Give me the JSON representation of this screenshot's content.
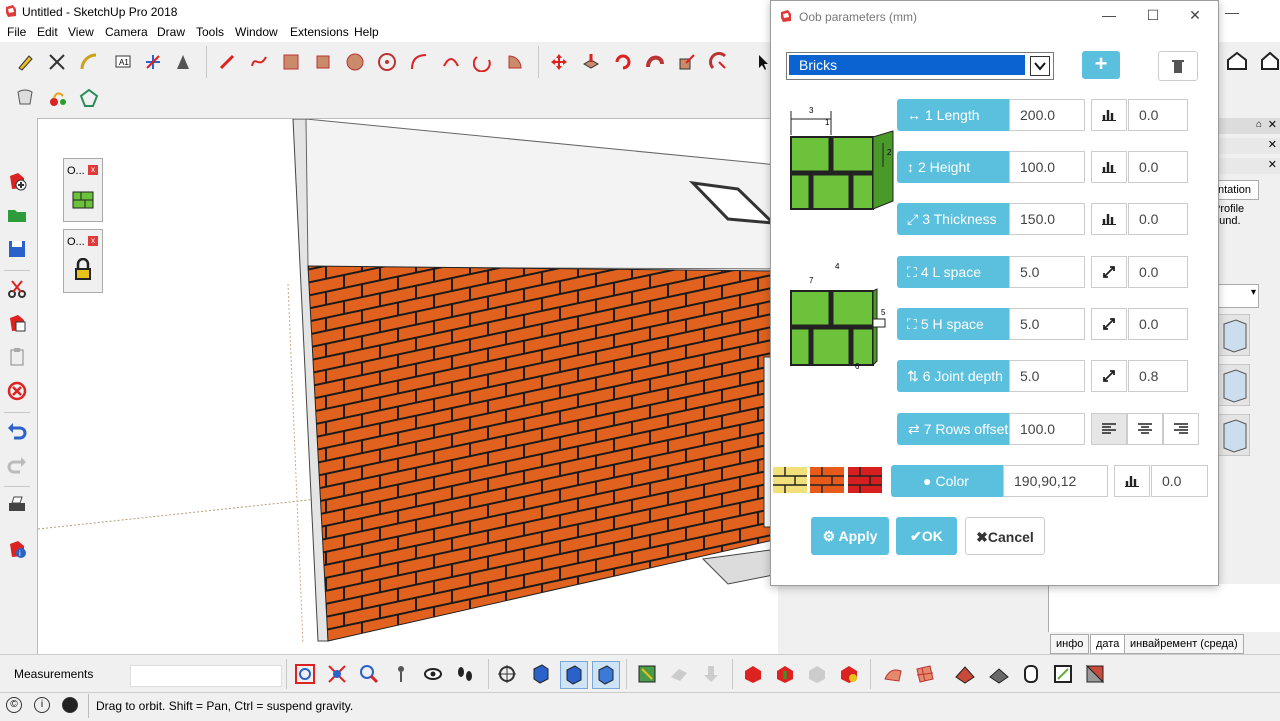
{
  "window": {
    "title": "Untitled - SketchUp Pro 2018"
  },
  "menu": [
    "File",
    "Edit",
    "View",
    "Camera",
    "Draw",
    "Tools",
    "Window",
    "Extensions",
    "Help"
  ],
  "mini_toolbars": [
    {
      "label": "O..."
    },
    {
      "label": "O..."
    }
  ],
  "dialog": {
    "title": "Oob parameters (mm)",
    "preset": "Bricks",
    "params": [
      {
        "label": "1 Length",
        "value": "200.0",
        "extra": "0.0",
        "icon": "arrows-horizontal-icon",
        "mode": "bar-chart-icon"
      },
      {
        "label": "2 Height",
        "value": "100.0",
        "extra": "0.0",
        "icon": "arrows-vertical-icon",
        "mode": "bar-chart-icon"
      },
      {
        "label": "3 Thickness",
        "value": "150.0",
        "extra": "0.0",
        "icon": "arrows-diagonal-icon",
        "mode": "bar-chart-icon"
      },
      {
        "label": "4 L space",
        "value": "5.0",
        "extra": "0.0",
        "icon": "compress-icon",
        "mode": "expand-icon"
      },
      {
        "label": "5 H space",
        "value": "5.0",
        "extra": "0.0",
        "icon": "compress-icon",
        "mode": "expand-icon"
      },
      {
        "label": "6 Joint depth",
        "value": "5.0",
        "extra": "0.8",
        "icon": "sort-icon",
        "mode": "expand-icon"
      }
    ],
    "rows_offset": {
      "label": "7 Rows offset",
      "value": "100.0"
    },
    "color": {
      "label": "Color",
      "value": "190,90,12",
      "extra": "0.0"
    },
    "swatches": [
      "#f2e07a",
      "#e85a1a",
      "#d61f1f"
    ],
    "buttons": {
      "apply": "Apply",
      "ok": "OK",
      "cancel": "Cancel"
    }
  },
  "right_panel": {
    "text1": "ntation",
    "text2a": "Profile",
    "text2b": "ound."
  },
  "tabs": [
    "инфо",
    "дата",
    "инвайремент (среда)"
  ],
  "measurements": {
    "label": "Measurements"
  },
  "status": {
    "text": "Drag to orbit. Shift = Pan, Ctrl = suspend gravity."
  },
  "colors": {
    "accent": "#5bc0de",
    "brick": "#e0621e",
    "mortar": "#1a1a1a",
    "select": "#0a63d0"
  }
}
